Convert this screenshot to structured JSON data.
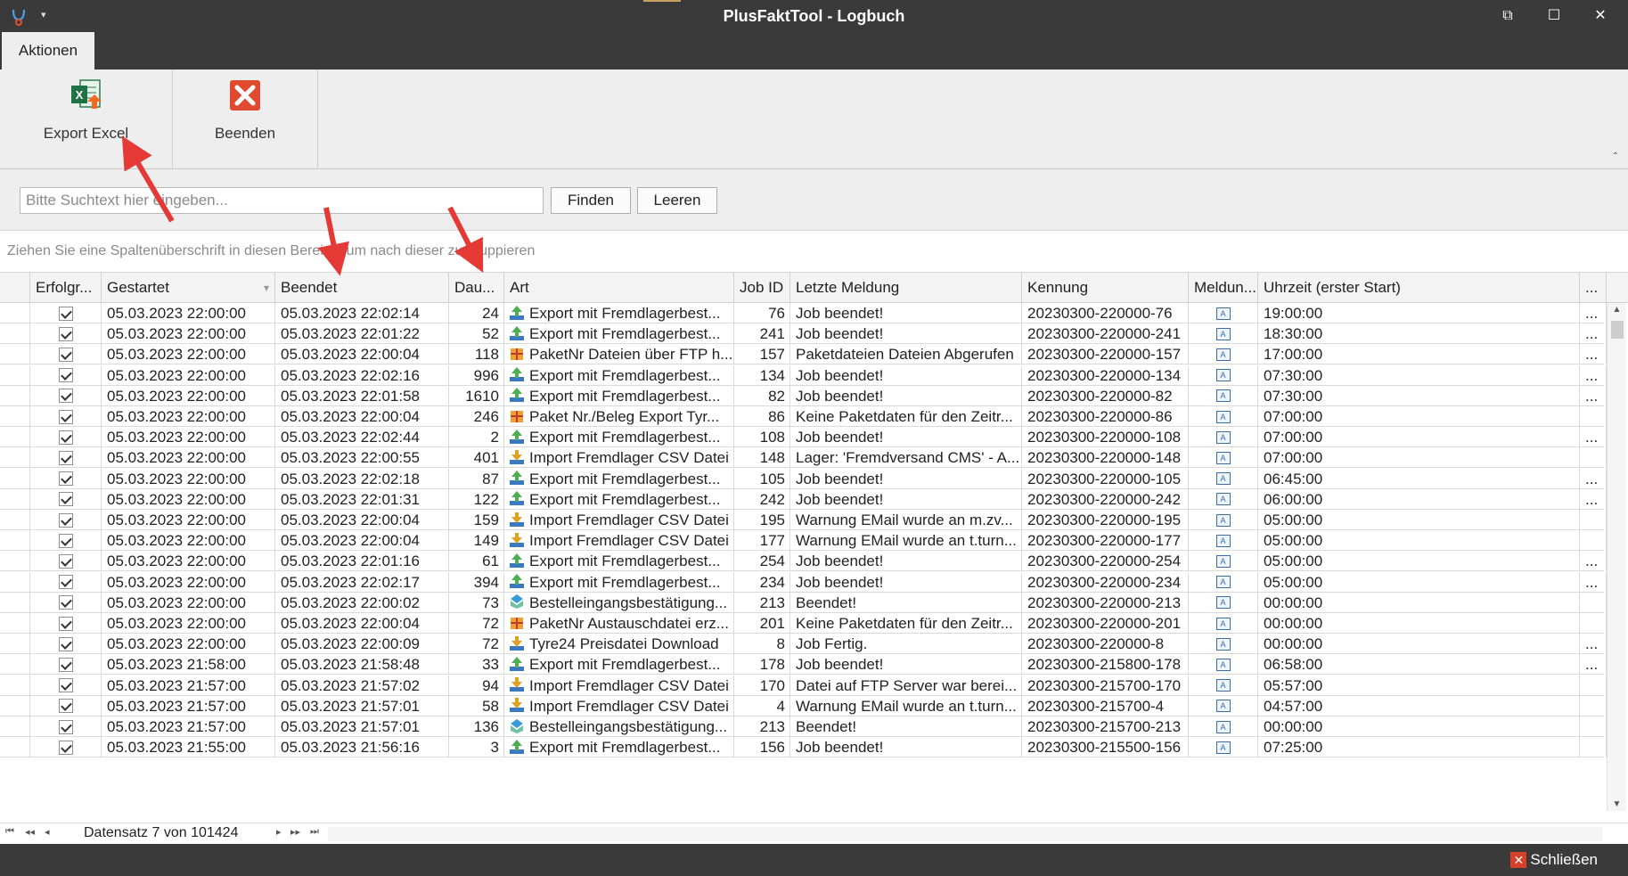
{
  "window": {
    "title": "PlusFaktTool - Logbuch",
    "quick_access_icon": "chevron-down-icon",
    "controls": [
      "restore-icon",
      "maximize-icon",
      "close-icon"
    ]
  },
  "ribbon": {
    "active_tab": "Aktionen",
    "buttons": [
      {
        "label": "Export Excel",
        "icon": "excel-export-icon"
      },
      {
        "label": "Beenden",
        "icon": "close-red-icon"
      }
    ]
  },
  "search": {
    "placeholder": "Bitte Suchtext hier eingeben...",
    "find_label": "Finden",
    "clear_label": "Leeren"
  },
  "group_panel_text": "Ziehen Sie eine Spaltenüberschrift in diesen Bereich, um nach dieser zu gruppieren",
  "columns": [
    "Erfolgr...",
    "Gestartet",
    "Beendet",
    "Dau...",
    "Art",
    "Job ID",
    "Letzte Meldung",
    "Kennung",
    "Meldun...",
    "Uhrzeit (erster Start)",
    "..."
  ],
  "rows": [
    {
      "ok": true,
      "start": "05.03.2023 22:00:00",
      "end": "05.03.2023 22:02:14",
      "dur": "24",
      "icon": "export",
      "art": "Export mit Fremdlagerbest...",
      "job": "76",
      "msg": "Job beendet!",
      "kennung": "20230300-220000-76",
      "time": "19:00:00",
      "more": "..."
    },
    {
      "ok": true,
      "start": "05.03.2023 22:00:00",
      "end": "05.03.2023 22:01:22",
      "dur": "52",
      "icon": "export",
      "art": "Export mit Fremdlagerbest...",
      "job": "241",
      "msg": "Job beendet!",
      "kennung": "20230300-220000-241",
      "time": "18:30:00",
      "more": "..."
    },
    {
      "ok": true,
      "start": "05.03.2023 22:00:00",
      "end": "05.03.2023 22:00:04",
      "dur": "118",
      "icon": "package",
      "art": "PaketNr Dateien über FTP h...",
      "job": "157",
      "msg": "Paketdateien Dateien Abgerufen",
      "kennung": "20230300-220000-157",
      "time": "17:00:00",
      "more": "..."
    },
    {
      "ok": true,
      "start": "05.03.2023 22:00:00",
      "end": "05.03.2023 22:02:16",
      "dur": "996",
      "icon": "export",
      "art": "Export mit Fremdlagerbest...",
      "job": "134",
      "msg": "Job beendet!",
      "kennung": "20230300-220000-134",
      "time": "07:30:00",
      "more": "..."
    },
    {
      "ok": true,
      "start": "05.03.2023 22:00:00",
      "end": "05.03.2023 22:01:58",
      "dur": "1610",
      "icon": "export",
      "art": "Export mit Fremdlagerbest...",
      "job": "82",
      "msg": "Job beendet!",
      "kennung": "20230300-220000-82",
      "time": "07:30:00",
      "more": "..."
    },
    {
      "ok": true,
      "start": "05.03.2023 22:00:00",
      "end": "05.03.2023 22:00:04",
      "dur": "246",
      "icon": "package",
      "art": "Paket Nr./Beleg Export Tyr...",
      "job": "86",
      "msg": "Keine Paketdaten für den Zeitr...",
      "kennung": "20230300-220000-86",
      "time": "07:00:00",
      "more": ""
    },
    {
      "ok": true,
      "start": "05.03.2023 22:00:00",
      "end": "05.03.2023 22:02:44",
      "dur": "2",
      "icon": "export",
      "art": "Export mit Fremdlagerbest...",
      "job": "108",
      "msg": "Job beendet!",
      "kennung": "20230300-220000-108",
      "time": "07:00:00",
      "more": "..."
    },
    {
      "ok": true,
      "start": "05.03.2023 22:00:00",
      "end": "05.03.2023 22:00:55",
      "dur": "401",
      "icon": "import",
      "art": "Import Fremdlager CSV Datei",
      "job": "148",
      "msg": "Lager: 'Fremdversand CMS' - A...",
      "kennung": "20230300-220000-148",
      "time": "07:00:00",
      "more": ""
    },
    {
      "ok": true,
      "start": "05.03.2023 22:00:00",
      "end": "05.03.2023 22:02:18",
      "dur": "87",
      "icon": "export",
      "art": "Export mit Fremdlagerbest...",
      "job": "105",
      "msg": "Job beendet!",
      "kennung": "20230300-220000-105",
      "time": "06:45:00",
      "more": "..."
    },
    {
      "ok": true,
      "start": "05.03.2023 22:00:00",
      "end": "05.03.2023 22:01:31",
      "dur": "122",
      "icon": "export",
      "art": "Export mit Fremdlagerbest...",
      "job": "242",
      "msg": "Job beendet!",
      "kennung": "20230300-220000-242",
      "time": "06:00:00",
      "more": "..."
    },
    {
      "ok": true,
      "start": "05.03.2023 22:00:00",
      "end": "05.03.2023 22:00:04",
      "dur": "159",
      "icon": "import",
      "art": "Import Fremdlager CSV Datei",
      "job": "195",
      "msg": "Warnung EMail wurde an m.zv...",
      "kennung": "20230300-220000-195",
      "time": "05:00:00",
      "more": ""
    },
    {
      "ok": true,
      "start": "05.03.2023 22:00:00",
      "end": "05.03.2023 22:00:04",
      "dur": "149",
      "icon": "import",
      "art": "Import Fremdlager CSV Datei",
      "job": "177",
      "msg": "Warnung EMail wurde an t.turn...",
      "kennung": "20230300-220000-177",
      "time": "05:00:00",
      "more": ""
    },
    {
      "ok": true,
      "start": "05.03.2023 22:00:00",
      "end": "05.03.2023 22:01:16",
      "dur": "61",
      "icon": "export",
      "art": "Export mit Fremdlagerbest...",
      "job": "254",
      "msg": "Job beendet!",
      "kennung": "20230300-220000-254",
      "time": "05:00:00",
      "more": "..."
    },
    {
      "ok": true,
      "start": "05.03.2023 22:00:00",
      "end": "05.03.2023 22:02:17",
      "dur": "394",
      "icon": "export",
      "art": "Export mit Fremdlagerbest...",
      "job": "234",
      "msg": "Job beendet!",
      "kennung": "20230300-220000-234",
      "time": "05:00:00",
      "more": "..."
    },
    {
      "ok": true,
      "start": "05.03.2023 22:00:00",
      "end": "05.03.2023 22:00:02",
      "dur": "73",
      "icon": "order",
      "art": "Bestelleingangsbestätigung...",
      "job": "213",
      "msg": "Beendet!",
      "kennung": "20230300-220000-213",
      "time": "00:00:00",
      "more": ""
    },
    {
      "ok": true,
      "start": "05.03.2023 22:00:00",
      "end": "05.03.2023 22:00:04",
      "dur": "72",
      "icon": "package",
      "art": "PaketNr Austauschdatei erz...",
      "job": "201",
      "msg": "Keine Paketdaten für den Zeitr...",
      "kennung": "20230300-220000-201",
      "time": "00:00:00",
      "more": ""
    },
    {
      "ok": true,
      "start": "05.03.2023 22:00:00",
      "end": "05.03.2023 22:00:09",
      "dur": "72",
      "icon": "import",
      "art": "Tyre24 Preisdatei Download",
      "job": "8",
      "msg": "Job Fertig.",
      "kennung": "20230300-220000-8",
      "time": "00:00:00",
      "more": "..."
    },
    {
      "ok": true,
      "start": "05.03.2023 21:58:00",
      "end": "05.03.2023 21:58:48",
      "dur": "33",
      "icon": "export",
      "art": "Export mit Fremdlagerbest...",
      "job": "178",
      "msg": "Job beendet!",
      "kennung": "20230300-215800-178",
      "time": "06:58:00",
      "more": "..."
    },
    {
      "ok": true,
      "start": "05.03.2023 21:57:00",
      "end": "05.03.2023 21:57:02",
      "dur": "94",
      "icon": "import",
      "art": "Import Fremdlager CSV Datei",
      "job": "170",
      "msg": "Datei auf FTP Server war berei...",
      "kennung": "20230300-215700-170",
      "time": "05:57:00",
      "more": ""
    },
    {
      "ok": true,
      "start": "05.03.2023 21:57:00",
      "end": "05.03.2023 21:57:01",
      "dur": "58",
      "icon": "import",
      "art": "Import Fremdlager CSV Datei",
      "job": "4",
      "msg": "Warnung EMail wurde an t.turn...",
      "kennung": "20230300-215700-4",
      "time": "04:57:00",
      "more": ""
    },
    {
      "ok": true,
      "start": "05.03.2023 21:57:00",
      "end": "05.03.2023 21:57:01",
      "dur": "136",
      "icon": "order",
      "art": "Bestelleingangsbestätigung...",
      "job": "213",
      "msg": "Beendet!",
      "kennung": "20230300-215700-213",
      "time": "00:00:00",
      "more": ""
    },
    {
      "ok": true,
      "start": "05.03.2023 21:55:00",
      "end": "05.03.2023 21:56:16",
      "dur": "3",
      "icon": "export",
      "art": "Export mit Fremdlagerbest...",
      "job": "156",
      "msg": "Job beendet!",
      "kennung": "20230300-215500-156",
      "time": "07:25:00",
      "more": ""
    }
  ],
  "pager": {
    "record_text": "Datensatz 7 von 101424"
  },
  "statusbar": {
    "close_label": "Schließen"
  },
  "colors": {
    "titlebar": "#3a3a3a",
    "ribbon": "#eeeeee",
    "annotation_arrow": "#e53935",
    "export_icon": "#4caf50",
    "package_icon": "#f0a030",
    "order_icon": "#3a9ad9"
  }
}
